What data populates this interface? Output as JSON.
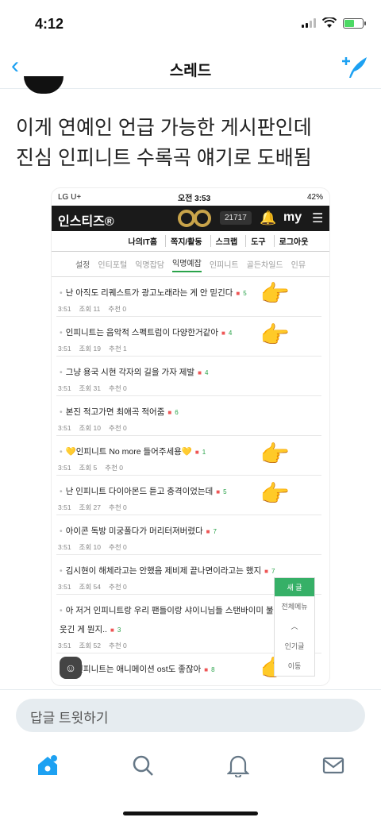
{
  "status_bar": {
    "time": "4:12"
  },
  "nav": {
    "title": "스레드"
  },
  "tweet": {
    "line1": "이게 연예인 언급 가능한 게시판인데",
    "line2": "진심 인피니트 수록곡 얘기로 도배됨"
  },
  "screenshot": {
    "status": {
      "carrier": "LG U+",
      "time": "오전 3:53",
      "battery": "42%"
    },
    "header": {
      "brand": "인스티즈®",
      "count": "21717",
      "my": "my"
    },
    "menu": [
      "나의IT홈",
      "쪽지/활동",
      "스크랩",
      "도구",
      "로그아웃"
    ],
    "tabs": [
      "설정",
      "인티포털",
      "익명잡담",
      "익명예잡",
      "인피니트",
      "골든차일드",
      "인뮤"
    ],
    "active_tab": "익명예잡",
    "posts": [
      {
        "title": "난 아직도 리퀘스트가 광고노래라는 게 안 믿긴다",
        "count": "5",
        "time": "3:51",
        "views": "조회 11",
        "recs": "추천 0"
      },
      {
        "title": "인피니트는 음악적 스펙트럼이 다양한거같아",
        "count": "4",
        "time": "3:51",
        "views": "조회 19",
        "recs": "추천 1"
      },
      {
        "title": "그냥 용국 시현 각자의 길을 가자 제발",
        "count": "4",
        "time": "3:51",
        "views": "조회 31",
        "recs": "추천 0"
      },
      {
        "title": "본진 적고가면 최애곡 적어줌",
        "count": "6",
        "time": "3:51",
        "views": "조회 10",
        "recs": "추천 0"
      },
      {
        "title": "💛인피니트 No more 들어주세용💛",
        "count": "1",
        "time": "3:51",
        "views": "조회 5",
        "recs": "추천 0"
      },
      {
        "title": "난 인피니트 다이아몬드 듣고 충격이었는데",
        "count": "5",
        "time": "3:51",
        "views": "조회 27",
        "recs": "추천 0"
      },
      {
        "title": "아이콘 독방 미궁폴다가 머리터져버렸다",
        "count": "7",
        "time": "3:51",
        "views": "조회 10",
        "recs": "추천 0"
      },
      {
        "title": "김시현이 해체라고는 안했음 제비제 끝나면이라고는 했지",
        "count": "7",
        "time": "3:51",
        "views": "조회 54",
        "recs": "추천 0"
      },
      {
        "title": "아 저거 인피니트랑 우리 팬들이랑 샤이니님들 스탠바이미 불렀을 때",
        "title2": "웃긴 게 뭔지..",
        "count": "3",
        "time": "3:51",
        "views": "조회 52",
        "recs": "추천 0"
      },
      {
        "title": "대 인피니트는 애니메이션 ost도 좋잖아",
        "count": "8",
        "time": "",
        "views": "",
        "recs": ""
      }
    ],
    "fab": {
      "new": "새 글",
      "all": "전체메뉴",
      "popular": "인기글",
      "move": "이동"
    }
  },
  "reply": {
    "placeholder": "답글 트윗하기"
  }
}
